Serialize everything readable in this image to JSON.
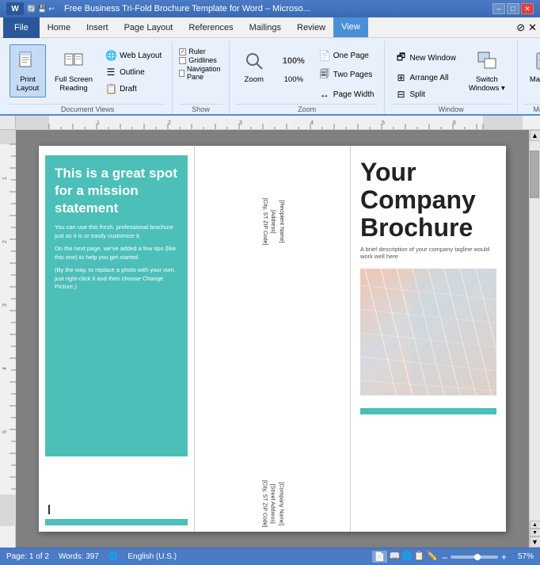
{
  "titleBar": {
    "title": "Free Business Tri-Fold Brochure Template for Word – Microsо...",
    "icons": [
      "W",
      "doc",
      "undo"
    ],
    "controls": [
      "–",
      "□",
      "✕"
    ]
  },
  "menuBar": {
    "items": [
      "File",
      "Home",
      "Insert",
      "Page Layout",
      "References",
      "Mailings",
      "Review",
      "View"
    ],
    "activeItem": "View",
    "rightIcons": [
      "?",
      "X"
    ]
  },
  "ribbon": {
    "groups": [
      {
        "name": "Document Views",
        "label": "Document Views",
        "buttons": [
          {
            "id": "print-layout",
            "label": "Print\nLayout",
            "active": true
          },
          {
            "id": "full-screen",
            "label": "Full Screen\nReading",
            "active": false
          }
        ],
        "smallButtons": [
          {
            "id": "web-layout",
            "label": "Web Layout"
          },
          {
            "id": "outline",
            "label": "Outline"
          },
          {
            "id": "draft",
            "label": "Draft"
          }
        ]
      },
      {
        "name": "Show",
        "label": "Show",
        "checkboxes": [
          {
            "id": "ruler",
            "label": "Ruler",
            "checked": true
          },
          {
            "id": "gridlines",
            "label": "Gridlines",
            "checked": false
          },
          {
            "id": "navigation",
            "label": "Navigation Pane",
            "checked": false
          }
        ]
      },
      {
        "name": "Zoom",
        "label": "Zoom",
        "buttons": [
          {
            "id": "zoom-btn",
            "label": "Zoom",
            "value": "🔍"
          },
          {
            "id": "zoom-100",
            "label": "100%",
            "value": "100%"
          },
          {
            "id": "one-page",
            "label": "One Page",
            "value": "📄"
          },
          {
            "id": "two-pages",
            "label": "Two Pages",
            "value": "📄📄"
          },
          {
            "id": "page-width",
            "label": "Page Width",
            "value": "↔"
          }
        ]
      },
      {
        "name": "Window",
        "label": "Window",
        "buttons": [
          {
            "id": "new-window",
            "label": "New Window"
          },
          {
            "id": "arrange-all",
            "label": "Arrange All"
          },
          {
            "id": "split",
            "label": "Split"
          },
          {
            "id": "switch-windows",
            "label": "Switch\nWindows",
            "dropdown": true
          }
        ]
      },
      {
        "name": "Macros",
        "label": "Macros",
        "buttons": [
          {
            "id": "macros",
            "label": "Macros",
            "dropdown": true
          }
        ]
      }
    ]
  },
  "document": {
    "leftPanel": {
      "missionTitle": "This is a great spot for a mission statement",
      "body1": "You can use this fresh, professional brochure just as it is or easily customize it.",
      "body2": "On the next page, we've added a few tips (like this one) to help you get started.",
      "body3": "(By the way, to replace a photo with your own, just right-click it and then choose Change Picture.)"
    },
    "middlePanel": {
      "addressTop": "[Recipient Name]\n[Address]\n[City, ST ZIP Code]",
      "addressBottom": "[Company Name]\n[Street Address]\n[City, ST ZIP Code]"
    },
    "rightPanel": {
      "companyName": "Your\nCompany\nBrochure",
      "tagline": "A brief description of your company tagline\nwould work well here"
    }
  },
  "statusBar": {
    "page": "Page: 1 of 2",
    "words": "Words: 397",
    "language": "English (U.S.)",
    "zoomPercent": "57%",
    "viewIcons": [
      "📄",
      "📊",
      "📋",
      "✏️",
      "📰"
    ]
  }
}
